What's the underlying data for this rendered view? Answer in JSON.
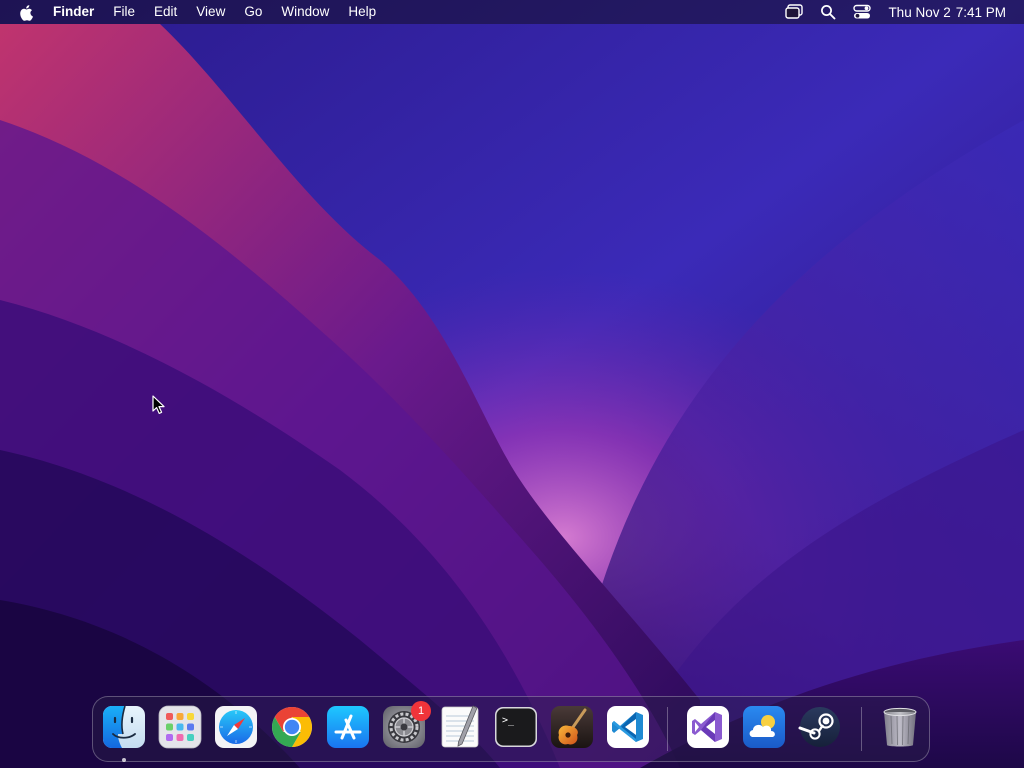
{
  "menubar": {
    "apple_icon": "apple-logo",
    "app_name": "Finder",
    "menus": [
      "File",
      "Edit",
      "View",
      "Go",
      "Window",
      "Help"
    ],
    "status_icons": [
      "screen-mirroring-icon",
      "spotlight-search-icon",
      "control-center-icon"
    ],
    "clock": {
      "date": "Thu Nov 2",
      "time": "7:41 PM"
    }
  },
  "dock": {
    "apps": [
      {
        "icon": "finder-icon",
        "running": true
      },
      {
        "icon": "launchpad-icon"
      },
      {
        "icon": "safari-icon"
      },
      {
        "icon": "chrome-icon"
      },
      {
        "icon": "app-store-icon"
      },
      {
        "icon": "system-settings-icon",
        "badge": "1"
      },
      {
        "icon": "textedit-icon"
      },
      {
        "icon": "terminal-icon",
        "label": ">_"
      },
      {
        "icon": "garageband-icon"
      },
      {
        "icon": "vscode-icon"
      },
      {
        "icon": "visual-studio-icon"
      },
      {
        "icon": "weather-icon"
      },
      {
        "icon": "steam-icon"
      },
      {
        "icon": "trash-icon"
      }
    ]
  },
  "colors": {
    "wallpaper_deep": "#1c0d5e",
    "wallpaper_magenta": "#b02a8a",
    "wallpaper_glow": "#e07ad0",
    "badge_red": "#f0343a",
    "vscode_blue": "#1f8ad2",
    "app_store_blue": "#1a8cff"
  }
}
